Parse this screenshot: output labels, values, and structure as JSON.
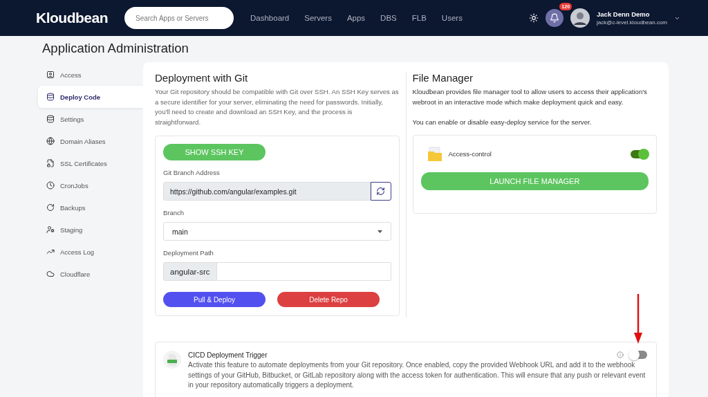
{
  "header": {
    "logo": "Kloudbean",
    "search": {
      "placeholder": "Search Apps or Servers"
    },
    "nav": [
      {
        "label": "Dashboard",
        "selected": false
      },
      {
        "label": "Servers",
        "selected": false
      },
      {
        "label": "Apps",
        "selected": false
      },
      {
        "label": "DBS",
        "selected": false
      },
      {
        "label": "FLB",
        "selected": false
      },
      {
        "label": "Users",
        "selected": false
      }
    ],
    "notifications": "120",
    "user": {
      "name": "Jack Denn Demo",
      "email": "jack@c-level.kloudbean.com"
    }
  },
  "page_title": "Application Administration",
  "sidebar": {
    "items": [
      {
        "label": "Access",
        "selected": false
      },
      {
        "label": "Deploy Code",
        "selected": true
      },
      {
        "label": "Settings",
        "selected": false
      },
      {
        "label": "Domain Aliases",
        "selected": false
      },
      {
        "label": "SSL Certificates",
        "selected": false
      },
      {
        "label": "CronJobs",
        "selected": false
      },
      {
        "label": "Backups",
        "selected": false
      },
      {
        "label": "Staging",
        "selected": false
      },
      {
        "label": "Access Log",
        "selected": false
      },
      {
        "label": "Cloudflare",
        "selected": false
      }
    ]
  },
  "git": {
    "title": "Deployment with Git",
    "description": "Your Git repository should be compatible with Git over SSH. An SSH Key serves as a secure identifier for your server, eliminating the need for passwords. Initially, you'll need to create and download an SSH Key, and the process is straightforward.",
    "show_key_button": "SHOW SSH KEY",
    "address_label": "Git Branch Address",
    "address": "https://github.com/angular/examples.git",
    "branch_label": "Branch",
    "branch": "main",
    "path_label": "Deployment Path",
    "path_prefix": "angular-src",
    "deploy_button": "Pull & Deploy",
    "delete_button": "Delete Repo"
  },
  "file_manager": {
    "title": "File Manager",
    "description": "Kloudbean provides file manager tool to allow users to access their application's webroot in an interactive mode which make deployment quick and easy.",
    "note": "You can enable or disable easy-deploy service for the server.",
    "access_label": "Access-control",
    "access_on": true,
    "launch_button": "LAUNCH FILE MANAGER"
  },
  "cicd": {
    "title": "CICD Deployment Trigger",
    "description": "Activate this feature to automate deployments from your Git repository. Once enabled, copy the provided Webhook URL and add it to the webhook settings of your GitHub, Bitbucket, or GitLab repository along with the access token for authentication. This will ensure that any push or relevant event in your repository automatically triggers a deployment.",
    "on": false
  }
}
